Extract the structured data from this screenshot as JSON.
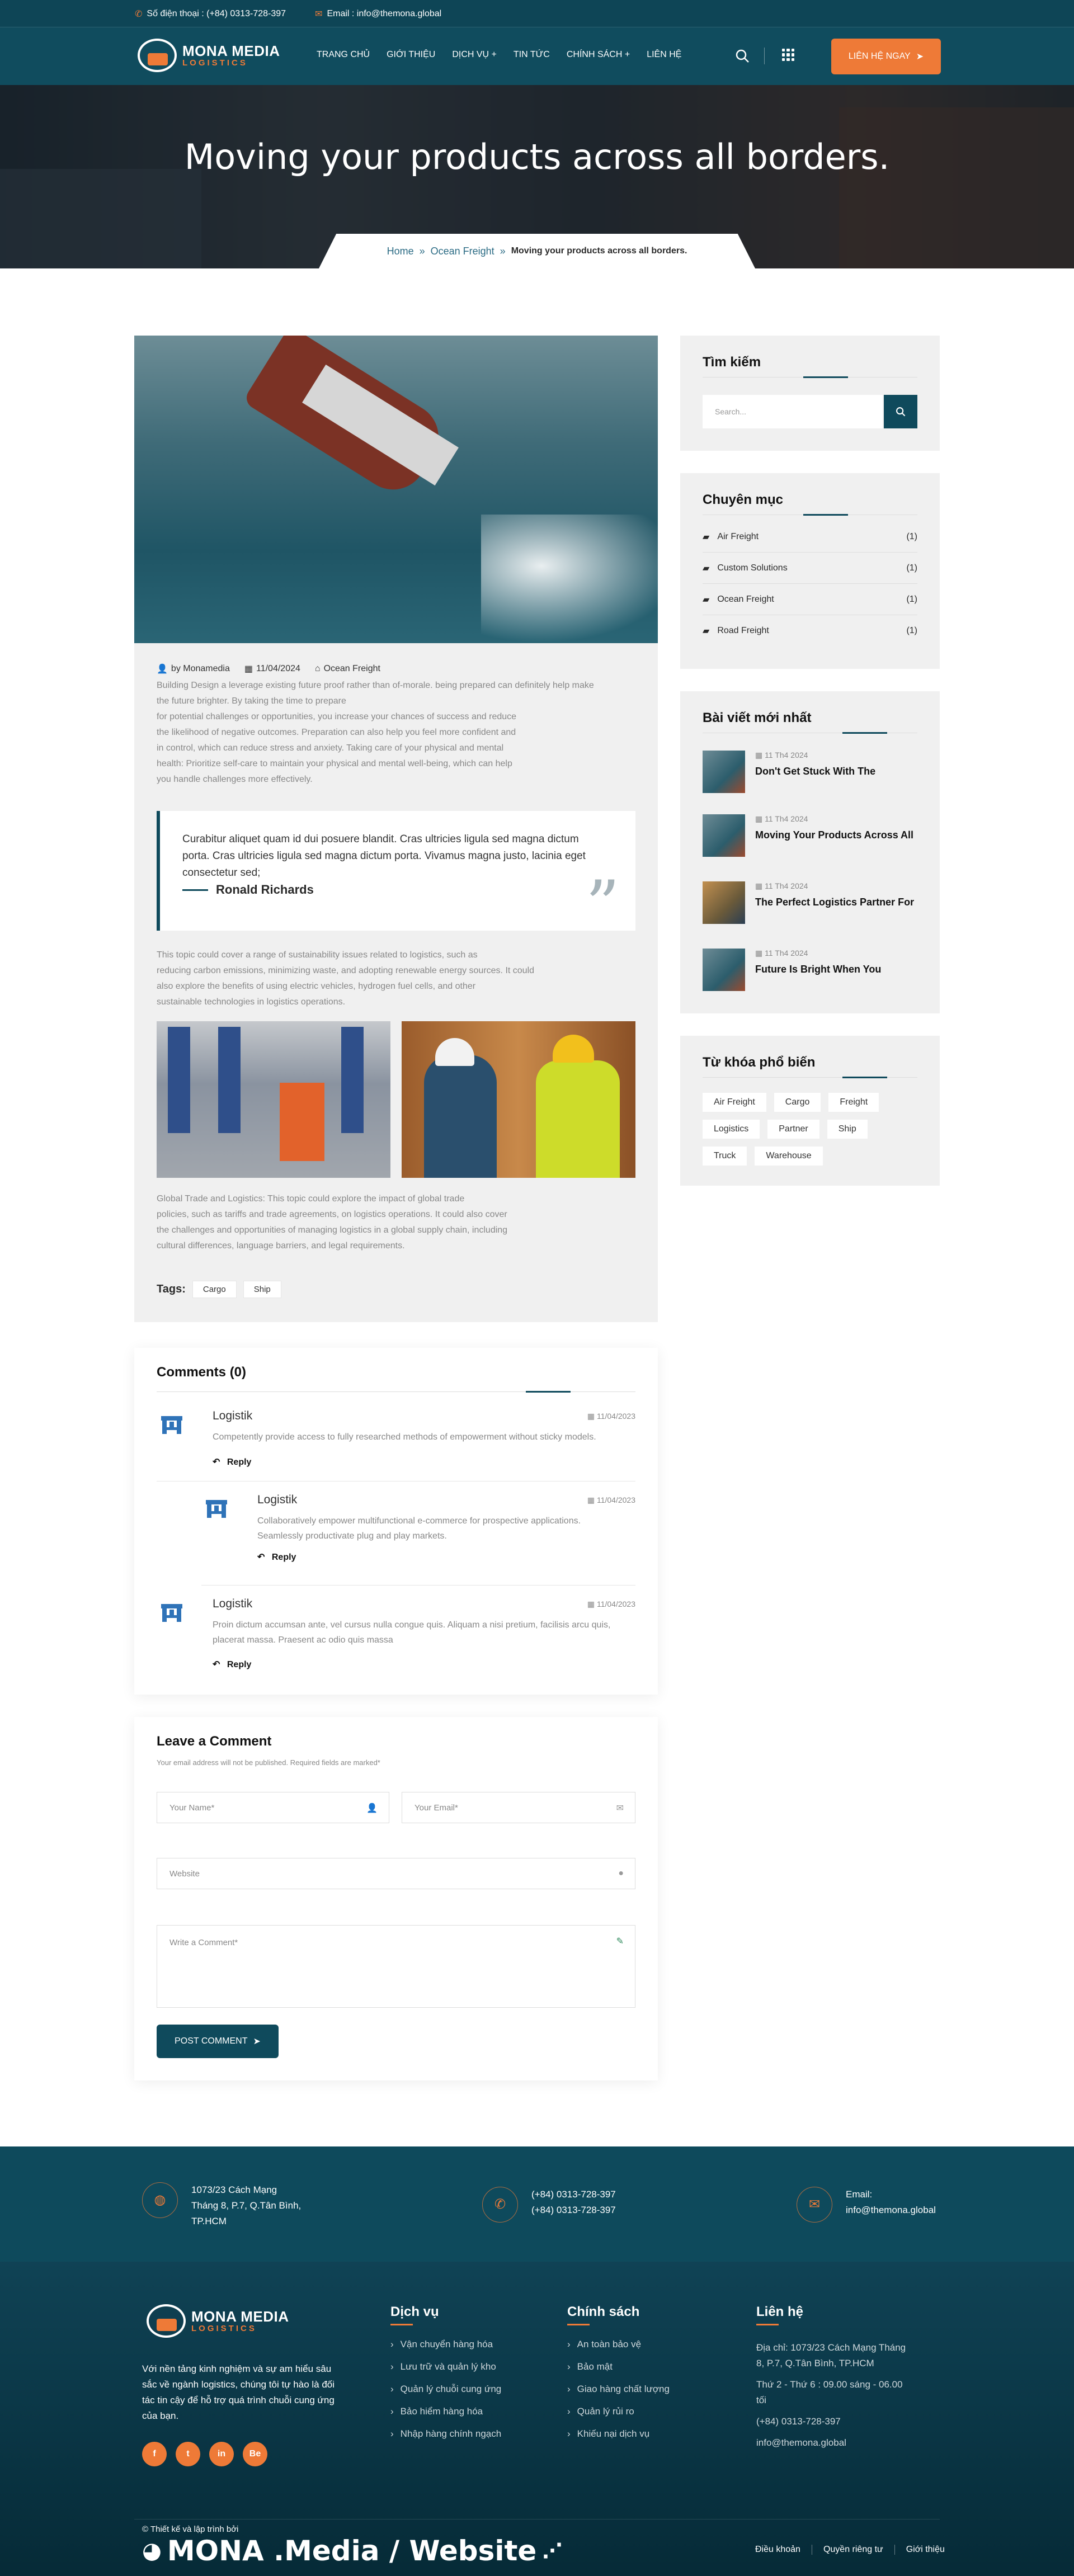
{
  "topbar": {
    "phone": "Số điện thoại : (+84) 0313-728-397",
    "email": "Email : info@themona.global"
  },
  "header": {
    "logo_main": "MONA MEDIA",
    "logo_sub": "LOGISTICS",
    "nav": [
      "TRANG CHỦ",
      "GIỚI THIỆU",
      "DỊCH VỤ +",
      "TIN TỨC",
      "CHÍNH SÁCH +",
      "LIÊN HỆ"
    ],
    "cta": "LIÊN HỆ NGAY"
  },
  "hero": {
    "title": "Moving your products across all borders."
  },
  "breadcrumb": {
    "home": "Home",
    "cat": "Ocean Freight",
    "current": "Moving your products across all borders."
  },
  "article": {
    "author": "by Monamedia",
    "date": "11/04/2024",
    "category": "Ocean Freight",
    "p1": [
      "Building Design a leverage existing future proof rather than of-morale. being prepared can definitely help make",
      "the future brighter. By taking the time to prepare",
      "for potential challenges or opportunities, you increase your chances of success and reduce",
      "the likelihood of negative outcomes. Preparation can also help you feel more confident and",
      "in control, which can reduce stress and anxiety. Taking care of your physical and mental",
      "health: Prioritize self-care to maintain your physical and mental well-being, which can help",
      "you handle challenges more effectively."
    ],
    "quote": "Curabitur aliquet quam id dui posuere blandit. Cras ultricies ligula sed magna dictum porta. Cras ultricies ligula sed magna dictum porta. Vivamus magna justo, lacinia eget consectetur sed;",
    "quote_author": "Ronald Richards",
    "p2": [
      "This topic could cover a range of sustainability issues related to logistics, such as",
      "reducing carbon emissions, minimizing waste, and adopting renewable energy sources. It could",
      "also explore the benefits of using electric vehicles, hydrogen fuel cells, and other",
      "sustainable technologies in logistics operations."
    ],
    "p3": [
      "Global Trade and Logistics: This topic could explore the impact of global trade",
      "policies, such as tariffs and trade agreements, on logistics operations. It could also cover",
      "the challenges and opportunities of managing logistics in a global supply chain, including",
      "cultural differences, language barriers, and legal requirements."
    ],
    "tags_label": "Tags:",
    "tags": [
      "Cargo",
      "Ship"
    ]
  },
  "comments": {
    "title": "Comments (0)",
    "items": [
      {
        "name": "Logistik",
        "date": "11/04/2023",
        "text": [
          "Competently provide access to fully researched methods of empowerment without sticky models."
        ],
        "reply": "Reply"
      },
      {
        "name": "Logistik",
        "date": "11/04/2023",
        "text": [
          "Collaboratively empower multifunctional e-commerce for prospective applications.",
          "Seamlessly productivate plug and play markets."
        ],
        "reply": "Reply"
      },
      {
        "name": "Logistik",
        "date": "11/04/2023",
        "text": [
          "Proin dictum accumsan ante, vel cursus nulla congue quis. Aliquam a nisi pretium, facilisis arcu quis,",
          "placerat massa. Praesent ac odio quis massa"
        ],
        "reply": "Reply"
      }
    ]
  },
  "leave": {
    "title": "Leave a Comment",
    "note": "Your email address will not be published. Required fields are marked*",
    "name_ph": "Your Name*",
    "email_ph": "Your Email*",
    "website_ph": "Website",
    "comment_ph": "Write a Comment*",
    "submit": "POST COMMENT"
  },
  "sidebar": {
    "search_title": "Tìm kiếm",
    "search_ph": "Search...",
    "cat_title": "Chuyên mục",
    "cats": [
      {
        "name": "Air Freight",
        "count": "(1)"
      },
      {
        "name": "Custom Solutions",
        "count": "(1)"
      },
      {
        "name": "Ocean Freight",
        "count": "(1)"
      },
      {
        "name": "Road Freight",
        "count": "(1)"
      }
    ],
    "recent_title": "Bài viết mới nhất",
    "recent": [
      {
        "date": "11 Th4 2024",
        "title": "Don't Get Stuck With The"
      },
      {
        "date": "11 Th4 2024",
        "title": "Moving Your Products Across All"
      },
      {
        "date": "11 Th4 2024",
        "title": "The Perfect Logistics Partner For"
      },
      {
        "date": "11 Th4 2024",
        "title": "Future Is Bright When You"
      }
    ],
    "kw_title": "Từ khóa phổ biến",
    "keywords": [
      "Air Freight",
      "Cargo",
      "Freight",
      "Logistics",
      "Partner",
      "Ship",
      "Truck",
      "Warehouse"
    ]
  },
  "contact": {
    "address": [
      "1073/23 Cách Mạng",
      "Tháng 8, P.7, Q.Tân Bình,",
      "TP.HCM"
    ],
    "phones": [
      "(+84) 0313-728-397",
      "(+84) 0313-728-397"
    ],
    "email": [
      "Email:",
      "info@themona.global"
    ]
  },
  "footer": {
    "logo_main": "MONA MEDIA",
    "logo_sub": "LOGISTICS",
    "about": [
      "Với nền tảng kinh nghiệm và sự am hiểu sâu",
      "sắc về ngành logistics, chúng tôi tự hào là đối",
      "tác tin cậy để hỗ trợ quá trình chuỗi cung ứng",
      "của bạn."
    ],
    "social": [
      "f",
      "t",
      "in",
      "Be"
    ],
    "services_title": "Dịch vụ",
    "services": [
      "Vận chuyển hàng hóa",
      "Lưu trữ và quản lý kho",
      "Quản lý chuỗi cung ứng",
      "Bảo hiểm hàng hóa",
      "Nhập hàng chính ngạch"
    ],
    "policy_title": "Chính sách",
    "policy": [
      "An toàn bảo vệ",
      "Bảo mật",
      "Giao hàng chất lượng",
      "Quản lý rủi ro",
      "Khiếu nại dịch vụ"
    ],
    "contact_title": "Liên hệ",
    "contact": [
      "Địa chỉ: 1073/23 Cách Mạng Tháng",
      "8, P.7, Q.Tân Bình, TP.HCM",
      "Thứ 2 - Thứ 6 : 09.00 sáng - 06.00",
      "tối",
      "(+84) 0313-728-397",
      "info@themona.global"
    ],
    "credit": "© Thiết kế và lập trình bởi",
    "brand": "MONA .Media / Website",
    "links": [
      "Điều khoản",
      "Quyền riêng tư",
      "Giới thiệu"
    ]
  }
}
